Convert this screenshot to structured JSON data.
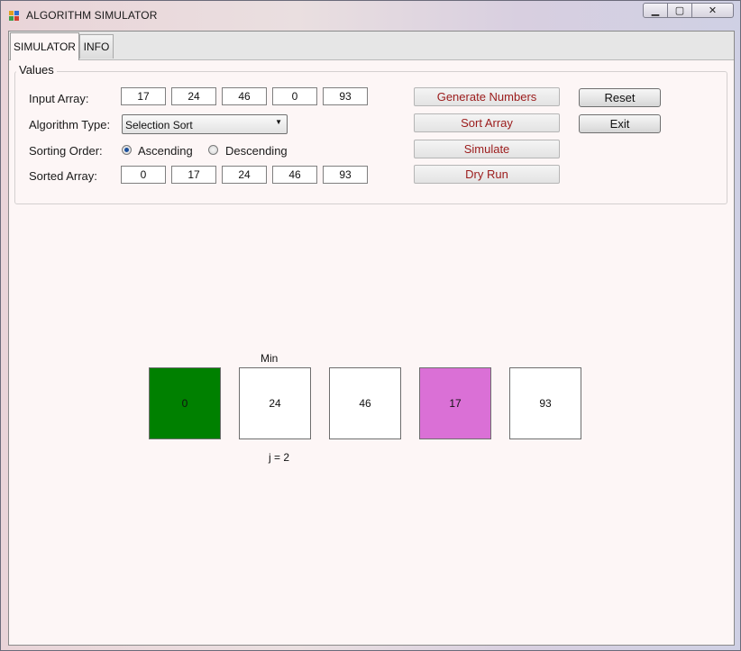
{
  "window": {
    "title": "ALGORITHM SIMULATOR",
    "icon": "app-icon",
    "controls": {
      "minimize": "▁",
      "maximize": "▢",
      "close": "✕"
    }
  },
  "tabs": [
    {
      "label": "SIMULATOR",
      "active": true
    },
    {
      "label": "INFO",
      "active": false
    }
  ],
  "values_group": {
    "title": "Values",
    "input_label": "Input Array:",
    "input_array": [
      "17",
      "24",
      "46",
      "0",
      "93"
    ],
    "algorithm_label": "Algorithm Type:",
    "algorithm_selected": "Selection Sort",
    "order_label": "Sorting Order:",
    "order_options": [
      {
        "label": "Ascending",
        "checked": true
      },
      {
        "label": "Descending",
        "checked": false
      }
    ],
    "sorted_label": "Sorted Array:",
    "sorted_array": [
      "0",
      "17",
      "24",
      "46",
      "93"
    ]
  },
  "actions": {
    "generate": "Generate Numbers",
    "sort": "Sort Array",
    "simulate": "Simulate",
    "dry_run": "Dry Run",
    "reset": "Reset",
    "exit": "Exit"
  },
  "visualization": {
    "min_label": "Min",
    "j_label": "j = 2",
    "boxes": [
      {
        "value": "0",
        "color": "#008000"
      },
      {
        "value": "24",
        "color": "#ffffff"
      },
      {
        "value": "46",
        "color": "#ffffff"
      },
      {
        "value": "17",
        "color": "#da70d6"
      },
      {
        "value": "93",
        "color": "#ffffff"
      }
    ]
  },
  "colors": {
    "action_text": "#9b1b1b",
    "sorted_highlight": "#008000",
    "compare_highlight": "#da70d6"
  }
}
